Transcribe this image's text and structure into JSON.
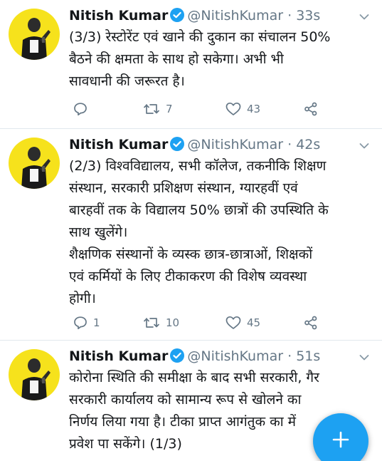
{
  "tweets": [
    {
      "name": "Nitish Kumar",
      "handle": "@NitishKumar",
      "separator": "·",
      "time": "33s",
      "text": "(3/3) रेस्टोरेंट एवं खाने की दुकान का संचालन 50%\nबैठने की क्षमता के साथ हो सकेगा। अभी भी\nसावधानी की जरूरत है।",
      "replies": "",
      "retweets": "7",
      "likes": "43"
    },
    {
      "name": "Nitish Kumar",
      "handle": "@NitishKumar",
      "separator": "·",
      "time": "42s",
      "text": "(2/3) विश्वविद्यालय, सभी कॉलेज, तकनीकि शिक्षण\nसंस्थान, सरकारी प्रशिक्षण संस्थान, ग्यारहवीं एवं\nबारहवीं तक के विद्यालय 50% छात्रों की उपस्थिति के\nसाथ खुलेंगे।\nशैक्षणिक संस्थानों के व्यस्क छात्र-छात्राओं, शिक्षकों\nएवं कर्मियों के लिए टीकाकरण की विशेष व्यवस्था\nहोगी।",
      "replies": "1",
      "retweets": "10",
      "likes": "45"
    },
    {
      "name": "Nitish Kumar",
      "handle": "@NitishKumar",
      "separator": "·",
      "time": "51s",
      "text": "कोरोना स्थिति की समीक्षा के बाद सभी सरकारी, गैर\nसरकारी कार्यालय को सामान्य रूप से खोलने का\nनिर्णय लिया गया है। टीका प्राप्त आगंतुक का      में\nप्रवेश पा सकेंगे। (1/3)",
      "replies": "",
      "retweets": "",
      "likes": ""
    }
  ],
  "icons": {
    "verified": "verified-badge-icon",
    "reply": "reply-icon",
    "retweet": "retweet-icon",
    "like": "heart-icon",
    "share": "share-icon",
    "caret": "chevron-down-icon",
    "compose": "plus-icon"
  },
  "colors": {
    "accent": "#1da1f2",
    "secondary_text": "#657786",
    "avatar_bg": "#f6e21c",
    "divider": "#e1e8ed"
  }
}
